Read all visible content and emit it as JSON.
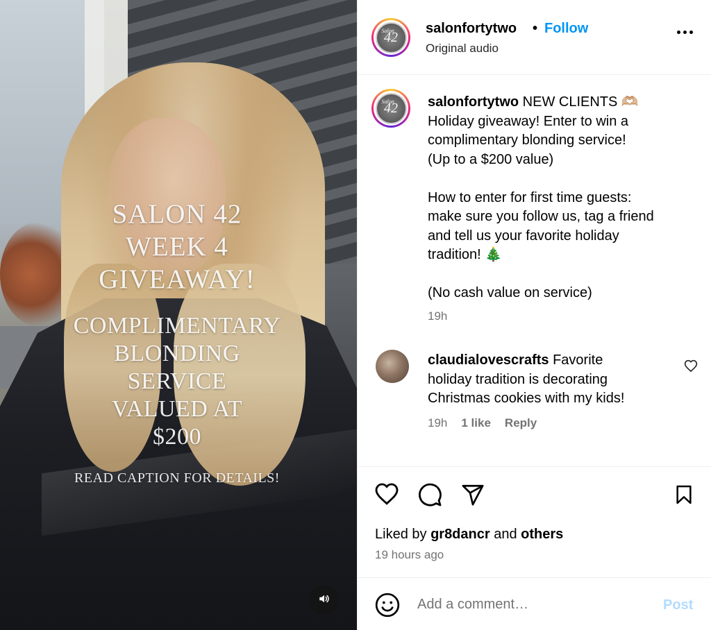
{
  "post": {
    "overlay": {
      "title_lines": [
        "SALON 42",
        "WEEK 4",
        "GIVEAWAY!"
      ],
      "body_lines": [
        "COMPLIMENTARY",
        "BLONDING",
        "SERVICE",
        "VALUED AT",
        "$200"
      ],
      "note": "READ CAPTION FOR DETAILS!"
    }
  },
  "header": {
    "username": "salonfortytwo",
    "separator": "•",
    "follow_label": "Follow",
    "audio_label": "Original audio",
    "avatar_text": "42",
    "avatar_small": "Salon"
  },
  "caption": {
    "username": "salonfortytwo",
    "line1": " NEW CLIENTS 🫶🏼",
    "line2": "Holiday giveaway! Enter to win a",
    "line3": "complimentary blonding service!",
    "line4": "(Up to a $200 value)",
    "line5": "How to enter for first time guests:",
    "line6": "make sure you follow us, tag a friend",
    "line7": "and tell us your favorite holiday",
    "line8": "tradition! 🎄",
    "line9": "(No cash value on service)",
    "time": "19h"
  },
  "comment": {
    "username": "claudialovescrafts",
    "text_line1": " Favorite",
    "text_line2": "holiday tradition is decorating",
    "text_line3": "Christmas cookies with my kids!",
    "time": "19h",
    "likes": "1 like",
    "reply_label": "Reply"
  },
  "engagement": {
    "liked_by_prefix": "Liked by ",
    "liked_by_user": "gr8dancr",
    "liked_by_and": " and ",
    "liked_by_others": "others",
    "posted_time": "19 hours ago"
  },
  "add_comment": {
    "placeholder": "Add a comment…",
    "post_label": "Post"
  }
}
